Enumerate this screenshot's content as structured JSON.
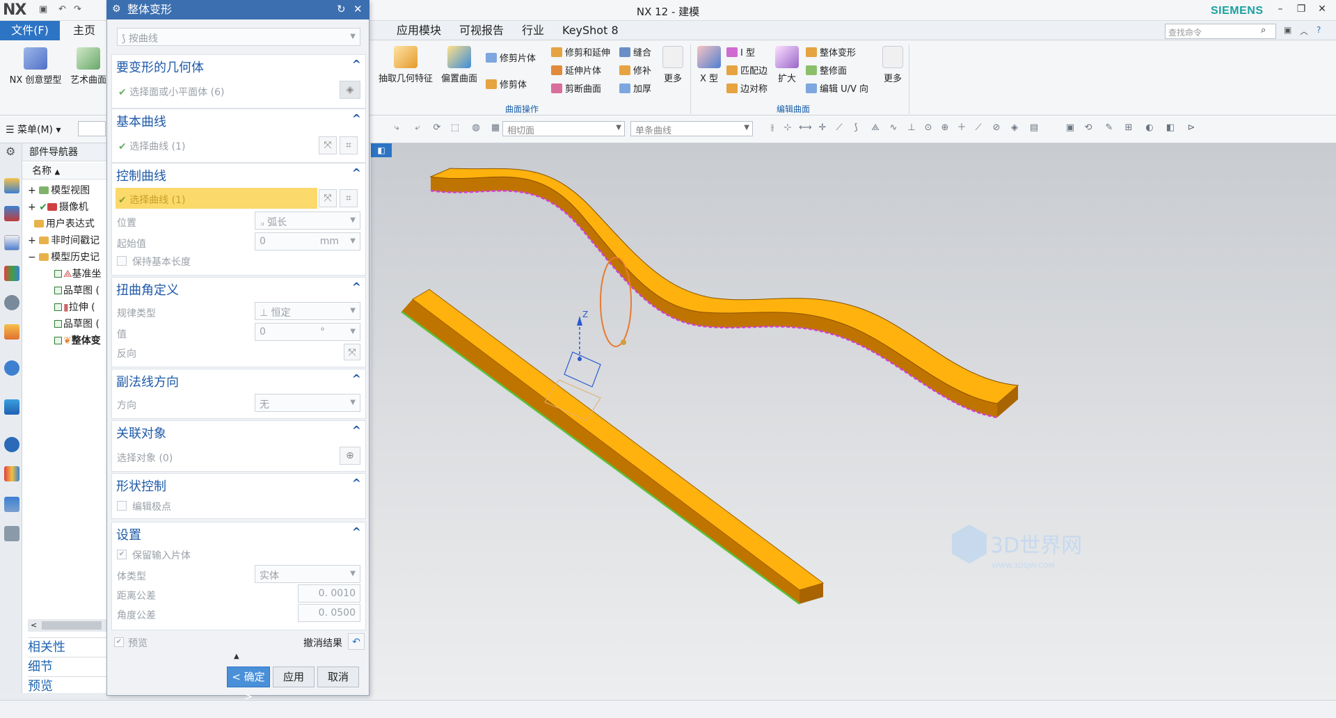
{
  "app": {
    "logo": "NX",
    "window_title": "NX 12 - 建模",
    "brand": "SIEMENS",
    "search_placeholder": "查找命令"
  },
  "tabs": {
    "file": "文件(F)",
    "home": "主页",
    "items": [
      "应用模块",
      "可视报告",
      "行业",
      "KeyShot 8"
    ]
  },
  "ribbon": {
    "left_big": [
      "NX 创意塑型",
      "艺术曲面"
    ],
    "surface_ops_big": [
      "抽取几何特征",
      "偏置曲面"
    ],
    "surface_ops_small": [
      "修剪片体",
      "修剪体",
      "修剪和延伸",
      "延伸片体",
      "剪断曲面",
      "缝合",
      "修补",
      "加厚"
    ],
    "more": "更多",
    "surface_ops_group": "曲面操作",
    "edit_big": [
      "X 型",
      "扩大"
    ],
    "edit_small": [
      "I 型",
      "匹配边",
      "边对称",
      "整体变形",
      "整修面",
      "编辑 U/V 向"
    ],
    "edit_group": "编辑曲面"
  },
  "toolbar": {
    "menu": "菜单(M)",
    "filter1": "相切面",
    "filter2": "单条曲线"
  },
  "navigator": {
    "title": "部件导航器",
    "column": "名称",
    "rows": [
      "模型视图",
      "摄像机",
      "用户表达式",
      "非时间戳记",
      "模型历史记",
      "基准坐",
      "草图 (",
      "拉伸 (",
      "草图 (",
      "整体变"
    ],
    "bottom": [
      "相关性",
      "细节",
      "预览"
    ]
  },
  "dialog": {
    "title": "整体变形",
    "type": "按曲线",
    "geom": {
      "title": "要变形的几何体",
      "select": "选择面或小平面体 (6)"
    },
    "base": {
      "title": "基本曲线",
      "select": "选择曲线 (1)"
    },
    "control": {
      "title": "控制曲线",
      "select": "选择曲线 (1)",
      "pos_label": "位置",
      "pos_value": "弧长",
      "start_label": "起始值",
      "start_value": "0",
      "start_unit": "mm",
      "keep_label": "保持基本长度"
    },
    "twist": {
      "title": "扭曲角定义",
      "law_label": "规律类型",
      "law_value": "恒定",
      "val_label": "值",
      "val_value": "0",
      "val_unit": "°",
      "rev_label": "反向"
    },
    "binormal": {
      "title": "副法线方向",
      "dir_label": "方向",
      "dir_value": "无"
    },
    "assoc": {
      "title": "关联对象",
      "select": "选择对象 (0)"
    },
    "shape": {
      "title": "形状控制",
      "edit": "编辑极点"
    },
    "settings": {
      "title": "设置",
      "keep": "保留输入片体",
      "body_label": "体类型",
      "body_value": "实体",
      "dist_label": "距离公差",
      "dist_value": "0. 0010",
      "angle_label": "角度公差",
      "angle_value": "0. 0500"
    },
    "preview": "预览",
    "undo": "撤消结果",
    "ok": "< 确定 >",
    "apply": "应用",
    "cancel": "取消"
  },
  "viewport": {
    "axis_label": "Z",
    "watermark": "3D世界网",
    "watermark_sub": "WWW.3DSJW.COM",
    "colors": {
      "body": "#ffb20d",
      "side": "#c07400",
      "edge_pink": "#d03fd6",
      "edge_green": "#59c23a"
    }
  }
}
